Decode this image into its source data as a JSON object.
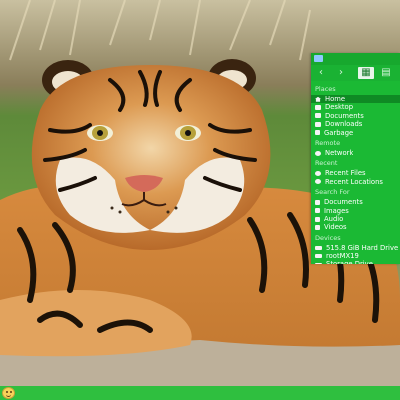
{
  "filemanager": {
    "toolbar": {
      "back": "‹",
      "forward": "›",
      "view_icons": "▦",
      "view_list": "▤"
    },
    "sections": [
      {
        "title": "Places",
        "items": [
          {
            "label": "Home",
            "icon": "home-icon",
            "selected": true
          },
          {
            "label": "Desktop",
            "icon": "folder-icon"
          },
          {
            "label": "Documents",
            "icon": "folder-icon"
          },
          {
            "label": "Downloads",
            "icon": "folder-icon"
          },
          {
            "label": "Garbage",
            "icon": "trash-icon"
          }
        ]
      },
      {
        "title": "Remote",
        "items": [
          {
            "label": "Network",
            "icon": "network-icon"
          }
        ]
      },
      {
        "title": "Recent",
        "items": [
          {
            "label": "Recent Files",
            "icon": "clock-icon"
          },
          {
            "label": "Recent Locations",
            "icon": "clock-icon"
          }
        ]
      },
      {
        "title": "Search For",
        "items": [
          {
            "label": "Documents",
            "icon": "document-icon"
          },
          {
            "label": "Images",
            "icon": "image-icon"
          },
          {
            "label": "Audio",
            "icon": "audio-icon"
          },
          {
            "label": "Videos",
            "icon": "video-icon"
          }
        ]
      },
      {
        "title": "Devices",
        "items": [
          {
            "label": "515.8 GiB Hard Drive",
            "icon": "drive-icon"
          },
          {
            "label": "rootMX19",
            "icon": "drive-icon"
          },
          {
            "label": "Storage Drive",
            "icon": "drive-icon"
          }
        ]
      }
    ]
  },
  "taskbar": {
    "menu_icon": "smiley-icon"
  },
  "colors": {
    "panel": "#1bb934",
    "selection": "#0f8a24",
    "taskbar": "#2fbf3f"
  }
}
